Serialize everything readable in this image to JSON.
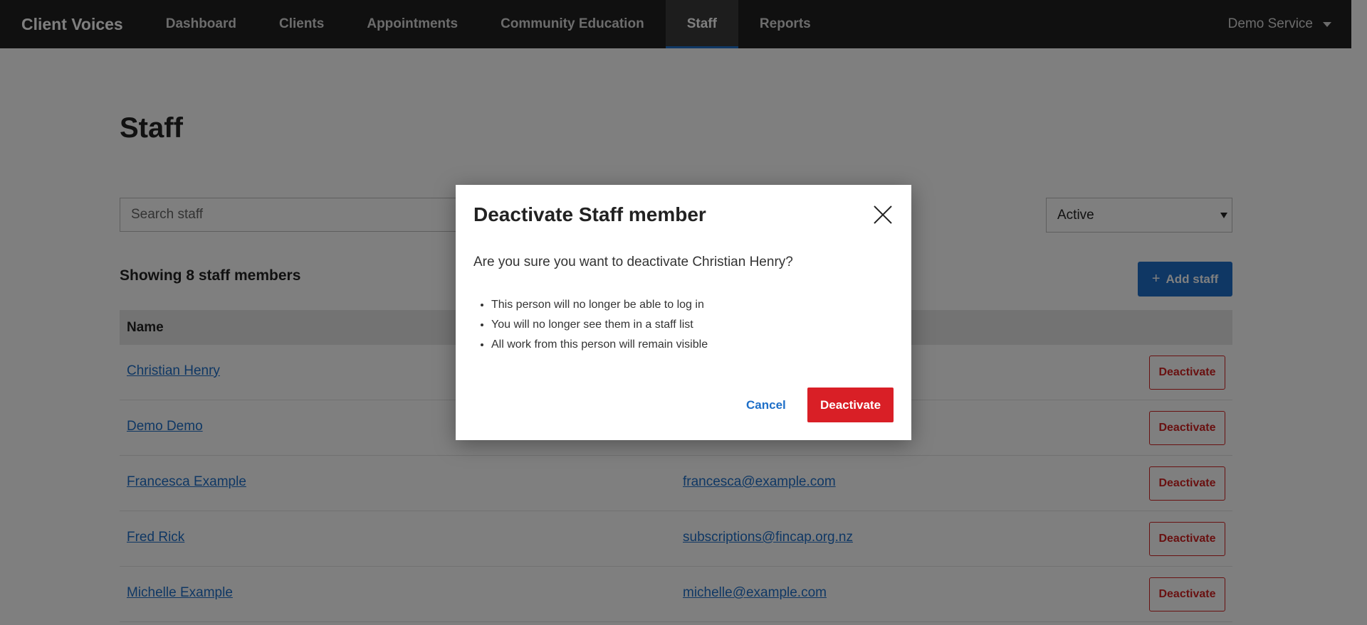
{
  "navbar": {
    "brand": "Client Voices",
    "items": [
      {
        "label": "Dashboard",
        "active": false
      },
      {
        "label": "Clients",
        "active": false
      },
      {
        "label": "Appointments",
        "active": false
      },
      {
        "label": "Community Education",
        "active": false
      },
      {
        "label": "Staff",
        "active": true
      },
      {
        "label": "Reports",
        "active": false
      }
    ],
    "account_label": "Demo Service"
  },
  "page": {
    "title": "Staff",
    "search_placeholder": "Search staff",
    "status_filter": "Active",
    "count_text": "Showing 8 staff members",
    "add_button_label": "Add staff",
    "table_header_name": "Name",
    "rows": [
      {
        "name": "Christian Henry",
        "email": "",
        "action": "Deactivate"
      },
      {
        "name": "Demo Demo",
        "email": "",
        "action": "Deactivate"
      },
      {
        "name": "Francesca Example",
        "email": "francesca@example.com",
        "action": "Deactivate"
      },
      {
        "name": "Fred Rick",
        "email": "subscriptions@fincap.org.nz",
        "action": "Deactivate"
      },
      {
        "name": "Michelle Example",
        "email": "michelle@example.com",
        "action": "Deactivate"
      }
    ]
  },
  "modal": {
    "title": "Deactivate Staff member",
    "question": "Are you sure you want to deactivate Christian Henry?",
    "bullets": [
      "This person will no longer be able to log in",
      "You will no longer see them in a staff list",
      "All work from this person will remain visible"
    ],
    "cancel_label": "Cancel",
    "confirm_label": "Deactivate"
  },
  "colors": {
    "navbar_bg": "#202020",
    "accent_blue": "#1e6fc8",
    "danger_red": "#d91f26"
  }
}
